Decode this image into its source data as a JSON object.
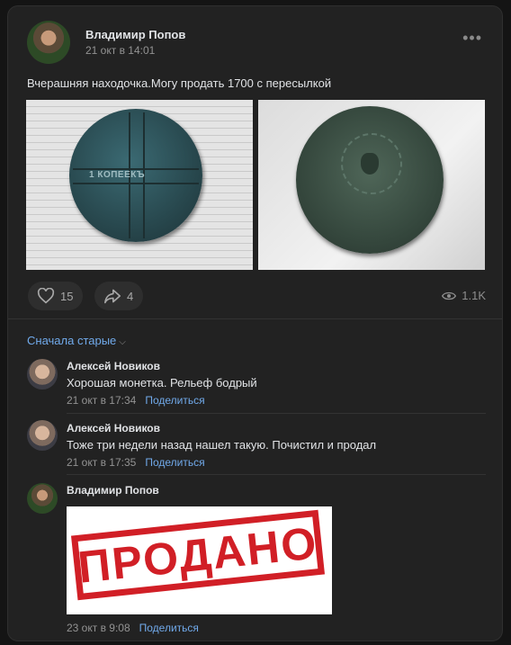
{
  "post": {
    "author": "Владимир Попов",
    "date": "21 окт в 14:01",
    "more": "•••",
    "text": "Вчерашняя находочка.Могу продать 1700 с пересылкой",
    "likes": "15",
    "shares": "4",
    "views": "1.1K",
    "photo1_coin_text": "1 КОПЕЕКЪ"
  },
  "comments": {
    "sort_label": "Сначала старые",
    "items": [
      {
        "author": "Алексей Новиков",
        "text": "Хорошая монетка. Рельеф бодрый",
        "date": "21 окт в 17:34",
        "share": "Поделиться"
      },
      {
        "author": "Алексей Новиков",
        "text": "Тоже три недели назад нашел такую. Почистил и продал",
        "date": "21 окт в 17:35",
        "share": "Поделиться"
      },
      {
        "author": "Владимир Попов",
        "image_text": "ПРОДАНО",
        "date": "23 окт в 9:08",
        "share": "Поделиться"
      }
    ]
  },
  "colors": {
    "accent": "#71aaeb",
    "background": "#222222",
    "stamp_red": "#d11f26"
  },
  "icons": {
    "like": "heart-icon",
    "share": "share-arrow-icon",
    "views": "eye-icon",
    "sort": "chevron-down-icon"
  }
}
